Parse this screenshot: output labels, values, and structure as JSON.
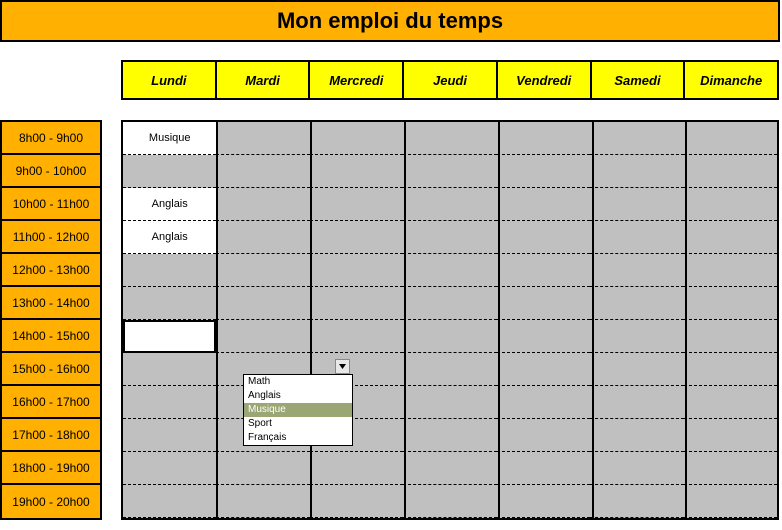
{
  "title": "Mon emploi du temps",
  "days": [
    "Lundi",
    "Mardi",
    "Mercredi",
    "Jeudi",
    "Vendredi",
    "Samedi",
    "Dimanche"
  ],
  "times": [
    "8h00 - 9h00",
    "9h00 - 10h00",
    "10h00 - 11h00",
    "11h00 - 12h00",
    "12h00 - 13h00",
    "13h00 - 14h00",
    "14h00 - 15h00",
    "15h00 - 16h00",
    "16h00 - 17h00",
    "17h00 - 18h00",
    "18h00 - 19h00",
    "19h00 - 20h00"
  ],
  "entries": {
    "r0c0": "Musique",
    "r2c0": "Anglais",
    "r3c0": "Anglais"
  },
  "dropdown": {
    "options": [
      "Math",
      "Anglais",
      "Musique",
      "Sport",
      "Français"
    ],
    "selected_index": 2
  },
  "active_cell": {
    "row": 6,
    "col": 0
  }
}
